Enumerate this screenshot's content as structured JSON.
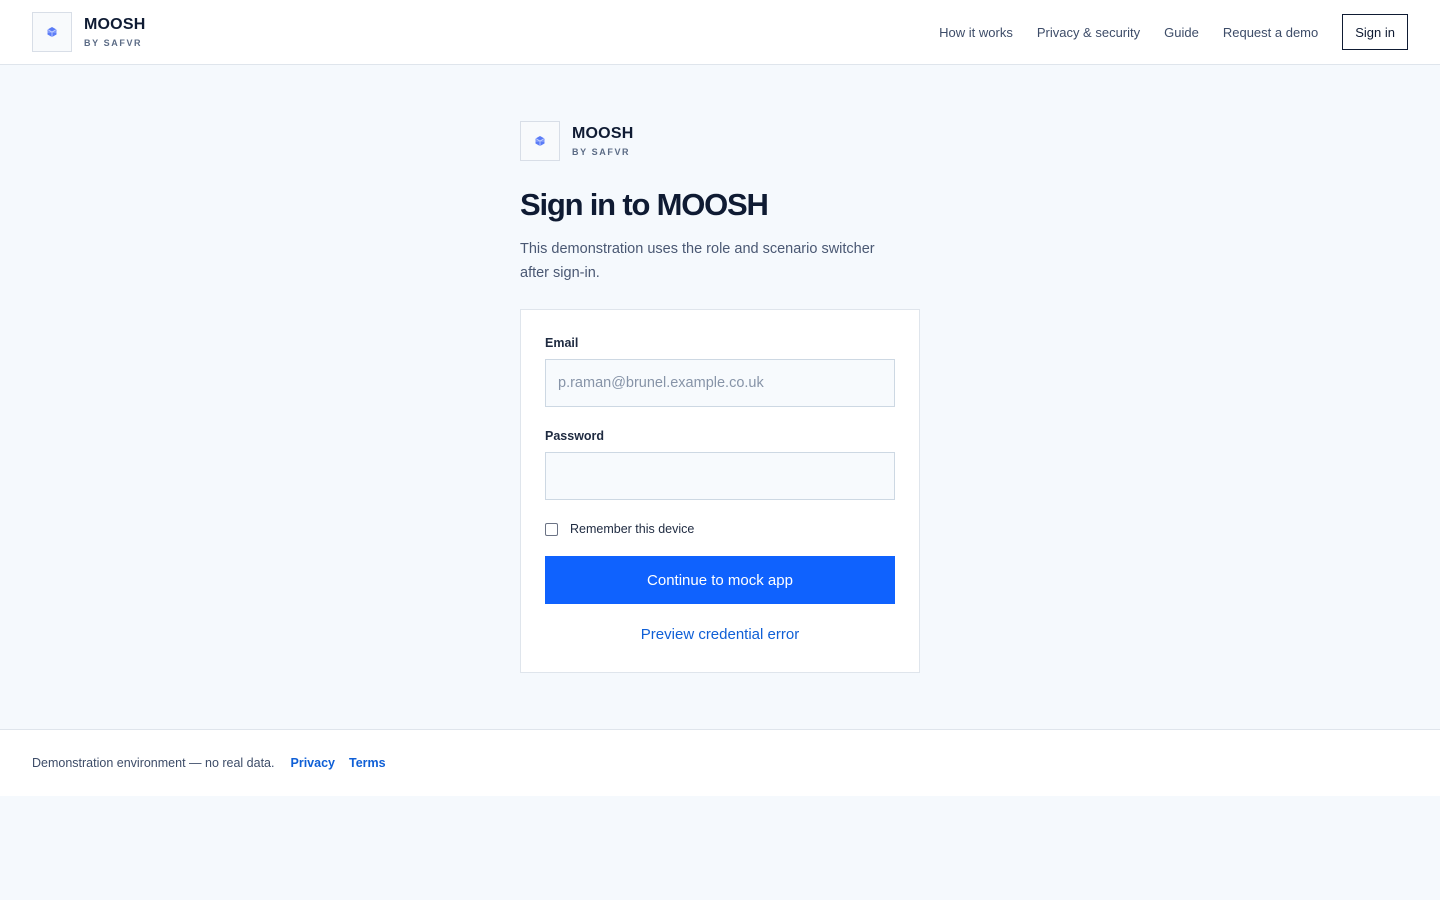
{
  "brand": {
    "name": "MOOSH",
    "tagline": "BY SAFVR",
    "accent": "#0f62fe"
  },
  "nav": {
    "links": [
      "How it works",
      "Privacy & security",
      "Guide",
      "Request a demo"
    ],
    "signin_label": "Sign in"
  },
  "main": {
    "title": "Sign in to MOOSH",
    "description": "This demonstration uses the role and scenario switcher after sign-in."
  },
  "form": {
    "email_label": "Email",
    "email_placeholder": "p.raman@brunel.example.co.uk",
    "email_value": "",
    "password_label": "Password",
    "password_value": "",
    "remember_label": "Remember this device",
    "remember_checked": false,
    "submit_label": "Continue to mock app",
    "error_link_label": "Preview credential error"
  },
  "footer": {
    "note": "Demonstration environment — no real data.",
    "privacy_label": "Privacy",
    "terms_label": "Terms"
  }
}
